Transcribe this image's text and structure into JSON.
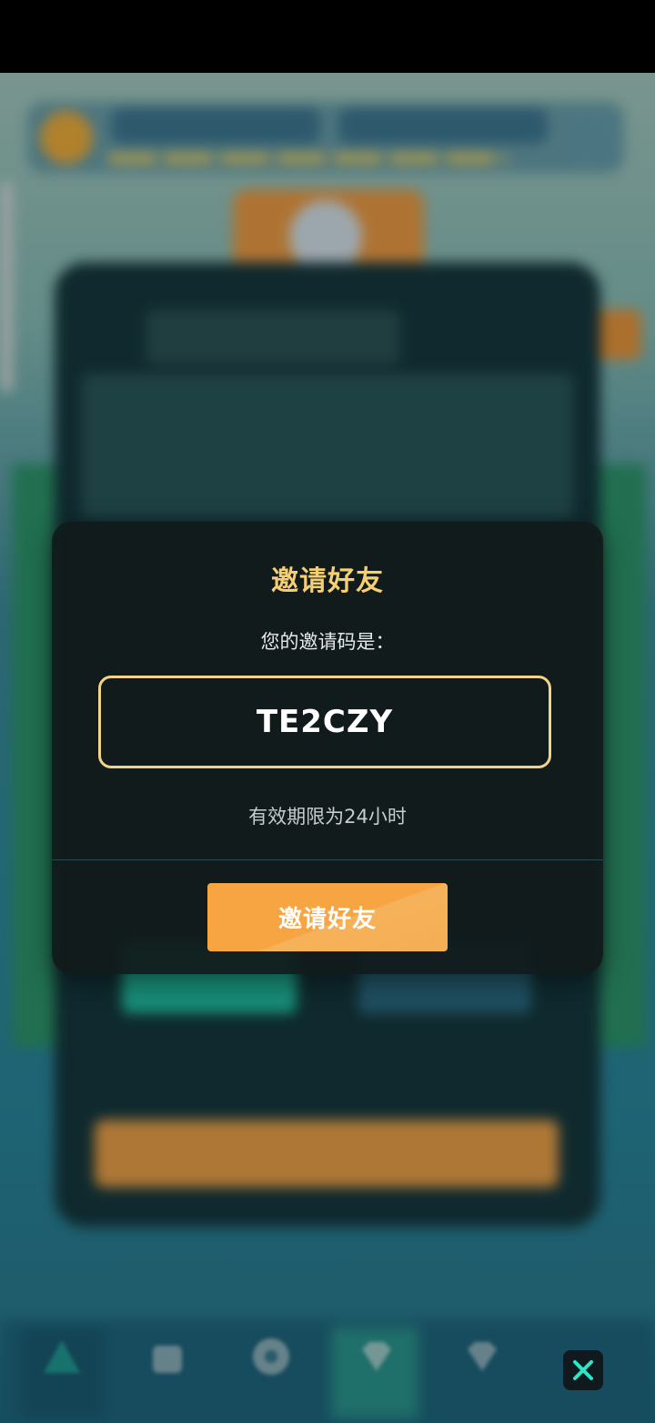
{
  "modal": {
    "title": "邀请好友",
    "subtitle": "您的邀请码是：",
    "invite_code": "TE2CZY",
    "validity_text": "有效期限为24小时",
    "invite_button_label": "邀请好友"
  },
  "colors": {
    "title_gold": "#f7cf73",
    "code_border": "#f2d38a",
    "button_orange": "#f7a542",
    "close_button_accent": "#2ee6c6"
  },
  "bottom_nav": {
    "icons": [
      "triangle-icon",
      "bag-icon",
      "compass-icon",
      "gem-icon",
      "heart-gem-icon"
    ]
  },
  "close_icon": "close-icon"
}
